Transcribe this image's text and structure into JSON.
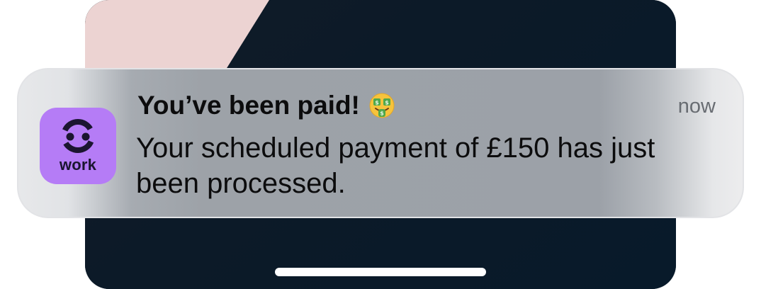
{
  "notification": {
    "app_icon": {
      "icon": "work-app-logo-icon",
      "label": "work",
      "background_color": "#b57cf6"
    },
    "title": "You’ve been paid!",
    "title_emoji": "money-mouth-face-icon",
    "body": "Your scheduled payment of £150 has just been processed.",
    "timestamp": "now"
  },
  "colors": {
    "wallpaper_dark": "#0b1b29",
    "wallpaper_pink": "#ecd3d2",
    "home_indicator": "#ffffff"
  }
}
